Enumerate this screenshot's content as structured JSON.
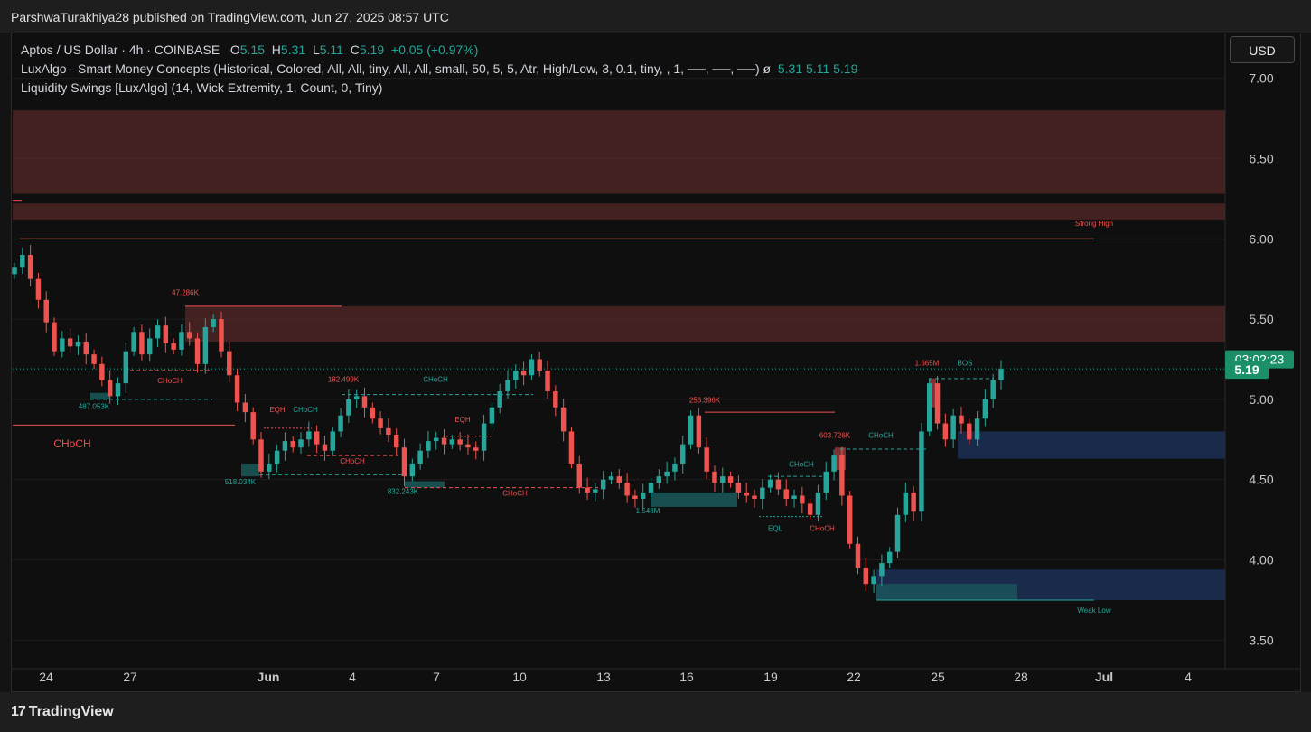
{
  "header": {
    "publisher_text": "ParshwaTurakhiya28 published on TradingView.com, Jun 27, 2025 08:57 UTC"
  },
  "legend": {
    "symbol": "Aptos / US Dollar · 4h · COINBASE",
    "o_label": "O",
    "o_value": "5.15",
    "h_label": "H",
    "h_value": "5.31",
    "l_label": "L",
    "l_value": "5.11",
    "c_label": "C",
    "c_value": "5.19",
    "change": "+0.05 (+0.97%)",
    "indicator1": "LuxAlgo - Smart Money Concepts (Historical, Colored, All, All, tiny, All, All, small, 50, 5, 5, Atr, High/Low, 3, 0.1, tiny, , 1, ──, ──, ──) ø",
    "indicator1_values": "5.31  5.11  5.19",
    "indicator2": "Liquidity Swings [LuxAlgo] (14, Wick Extremity, 1, Count, 0, Tiny)"
  },
  "currency_button": "USD",
  "footer": {
    "logo_mark": "17",
    "logo_text": "TradingView"
  },
  "colors": {
    "up": "#26a69a",
    "down": "#ef5350",
    "supply_zone": "#5a2a2a",
    "demand_zone": "#1c2e52",
    "price_tag": "#1b8f67"
  },
  "chart_data": {
    "type": "candlestick",
    "symbol": "APT/USD",
    "timeframe": "4h",
    "y_axis": {
      "range": [
        3.35,
        7.15
      ],
      "ticks": [
        "7.00",
        "6.50",
        "6.00",
        "5.50",
        "5.00",
        "4.50",
        "4.00",
        "3.50"
      ]
    },
    "x_axis": {
      "ticks": [
        "24",
        "27",
        "Jun",
        "4",
        "7",
        "10",
        "13",
        "16",
        "19",
        "22",
        "25",
        "28",
        "Jul",
        "4"
      ],
      "bold_ticks": [
        "Jun",
        "Jul"
      ]
    },
    "current_price": "5.19",
    "countdown": "03:02:23",
    "closes": [
      5.82,
      5.9,
      5.75,
      5.62,
      5.48,
      5.3,
      5.38,
      5.33,
      5.36,
      5.28,
      5.22,
      5.12,
      5.02,
      5.1,
      5.3,
      5.42,
      5.28,
      5.38,
      5.46,
      5.35,
      5.31,
      5.42,
      5.38,
      5.22,
      5.45,
      5.5,
      5.3,
      5.15,
      4.98,
      4.92,
      4.75,
      4.55,
      4.6,
      4.68,
      4.74,
      4.7,
      4.75,
      4.8,
      4.72,
      4.68,
      4.8,
      4.9,
      5.0,
      5.02,
      4.95,
      4.88,
      4.82,
      4.78,
      4.7,
      4.52,
      4.6,
      4.68,
      4.74,
      4.76,
      4.72,
      4.75,
      4.72,
      4.7,
      4.68,
      4.85,
      4.95,
      5.05,
      5.12,
      5.18,
      5.15,
      5.25,
      5.18,
      5.05,
      4.95,
      4.8,
      4.6,
      4.45,
      4.42,
      4.44,
      4.5,
      4.52,
      4.48,
      4.4,
      4.38,
      4.42,
      4.48,
      4.52,
      4.55,
      4.6,
      4.72,
      4.9,
      4.7,
      4.55,
      4.48,
      4.52,
      4.48,
      4.42,
      4.4,
      4.38,
      4.45,
      4.5,
      4.44,
      4.38,
      4.4,
      4.35,
      4.28,
      4.42,
      4.55,
      4.65,
      4.4,
      4.1,
      3.95,
      3.85,
      3.9,
      3.98,
      4.05,
      4.28,
      4.42,
      4.3,
      4.8,
      5.1,
      4.85,
      4.75,
      4.9,
      4.85,
      4.75,
      4.88,
      5.0,
      5.12,
      5.19
    ],
    "annotations": [
      {
        "text": "Strong High",
        "price": 6.0,
        "color": "#ef5350"
      },
      {
        "text": "Weak Low",
        "price": 3.75,
        "color": "#26a69a"
      },
      {
        "text": "47.286K",
        "color": "#ef5350"
      },
      {
        "text": "487.053K",
        "color": "#26a69a"
      },
      {
        "text": "CHoCH",
        "color": "#ef5350"
      },
      {
        "text": "CHoCH",
        "color": "#ef5350",
        "size": "large"
      },
      {
        "text": "182.499K",
        "color": "#ef5350"
      },
      {
        "text": "CHoCH",
        "color": "#26a69a"
      },
      {
        "text": "EQH",
        "color": "#ef5350"
      },
      {
        "text": "CHoCH",
        "color": "#26a69a"
      },
      {
        "text": "518.034K",
        "color": "#26a69a"
      },
      {
        "text": "CHoCH",
        "color": "#ef5350"
      },
      {
        "text": "832.243K",
        "color": "#26a69a"
      },
      {
        "text": "EQH",
        "color": "#ef5350"
      },
      {
        "text": "CHoCH",
        "color": "#ef5350"
      },
      {
        "text": "256.396K",
        "color": "#ef5350"
      },
      {
        "text": "1.548M",
        "color": "#26a69a"
      },
      {
        "text": "CHoCH",
        "color": "#26a69a"
      },
      {
        "text": "EQL",
        "color": "#26a69a"
      },
      {
        "text": "CHoCH",
        "color": "#ef5350"
      },
      {
        "text": "603.726K",
        "color": "#ef5350"
      },
      {
        "text": "CHoCH",
        "color": "#26a69a"
      },
      {
        "text": "1.665M",
        "color": "#ef5350"
      },
      {
        "text": "BOS",
        "color": "#26a69a"
      }
    ]
  }
}
